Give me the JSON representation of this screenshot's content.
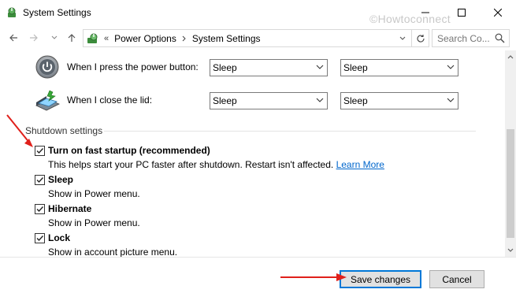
{
  "window": {
    "title": "System Settings",
    "watermark": "©Howtoconnect",
    "controls": {
      "minimize_icon": "minimize-icon",
      "maximize_icon": "maximize-icon",
      "close_icon": "close-icon"
    }
  },
  "nav": {
    "breadcrumb_separator": "«",
    "breadcrumbs": [
      "Power Options",
      "System Settings"
    ],
    "search_placeholder": "Search Co..."
  },
  "power_rows": [
    {
      "label": "When I press the power button:",
      "battery_value": "Sleep",
      "plugged_value": "Sleep",
      "icon": "power-button-icon"
    },
    {
      "label": "When I close the lid:",
      "battery_value": "Sleep",
      "plugged_value": "Sleep",
      "icon": "laptop-lid-icon"
    }
  ],
  "shutdown": {
    "section_title": "Shutdown settings",
    "options": [
      {
        "label": "Turn on fast startup (recommended)",
        "description": "This helps start your PC faster after shutdown. Restart isn't affected.",
        "link": "Learn More",
        "checked": true
      },
      {
        "label": "Sleep",
        "description": "Show in Power menu.",
        "checked": true
      },
      {
        "label": "Hibernate",
        "description": "Show in Power menu.",
        "checked": true
      },
      {
        "label": "Lock",
        "description": "Show in account picture menu.",
        "checked": true
      }
    ]
  },
  "footer": {
    "save_label": "Save changes",
    "cancel_label": "Cancel"
  },
  "colors": {
    "link": "#0066cc",
    "accent": "#0078d7",
    "annotation_arrow": "#e0201b"
  }
}
